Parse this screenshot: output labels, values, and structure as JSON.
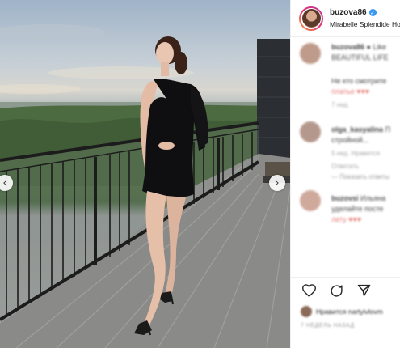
{
  "post": {
    "username": "buzova86",
    "location": "Mirabelle Splendide Hotel",
    "verified_icon": "verified-check-icon"
  },
  "comments": [
    {
      "user": "buzova86",
      "text": "● Like",
      "line2": "BEAUTIFUL LIFE",
      "meta": "",
      "avatar_color": "#b58a78"
    },
    {
      "user": "",
      "text": "Не кто смотрите",
      "line2": "платье ♥♥♥",
      "meta": "7 нед.",
      "avatar_color": "#ffffff"
    },
    {
      "user": "olga_kasyalina",
      "text": "П",
      "line2": "стройной...",
      "meta": "5 нед.   Нравится",
      "line3": "Ответить",
      "avatar_color": "#a9877a"
    },
    {
      "user": "buzovsi",
      "text": "Ильяна",
      "line2": "уделайте посте",
      "line3": "лету ♥♥♥",
      "meta": "",
      "avatar_color": "#c89b8c"
    }
  ],
  "more_replies": "— Показать ответы",
  "actions": {
    "like_icon": "heart-icon",
    "comment_icon": "comment-icon",
    "share_icon": "share-icon"
  },
  "liked_by": "Нравится nartyivlovm",
  "date": "7 НЕДЕЛЬ НАЗАД",
  "nav": {
    "prev": "‹",
    "next": "›"
  },
  "colors": {
    "accent": "#3897f0",
    "text": "#262626",
    "muted": "#999999"
  }
}
